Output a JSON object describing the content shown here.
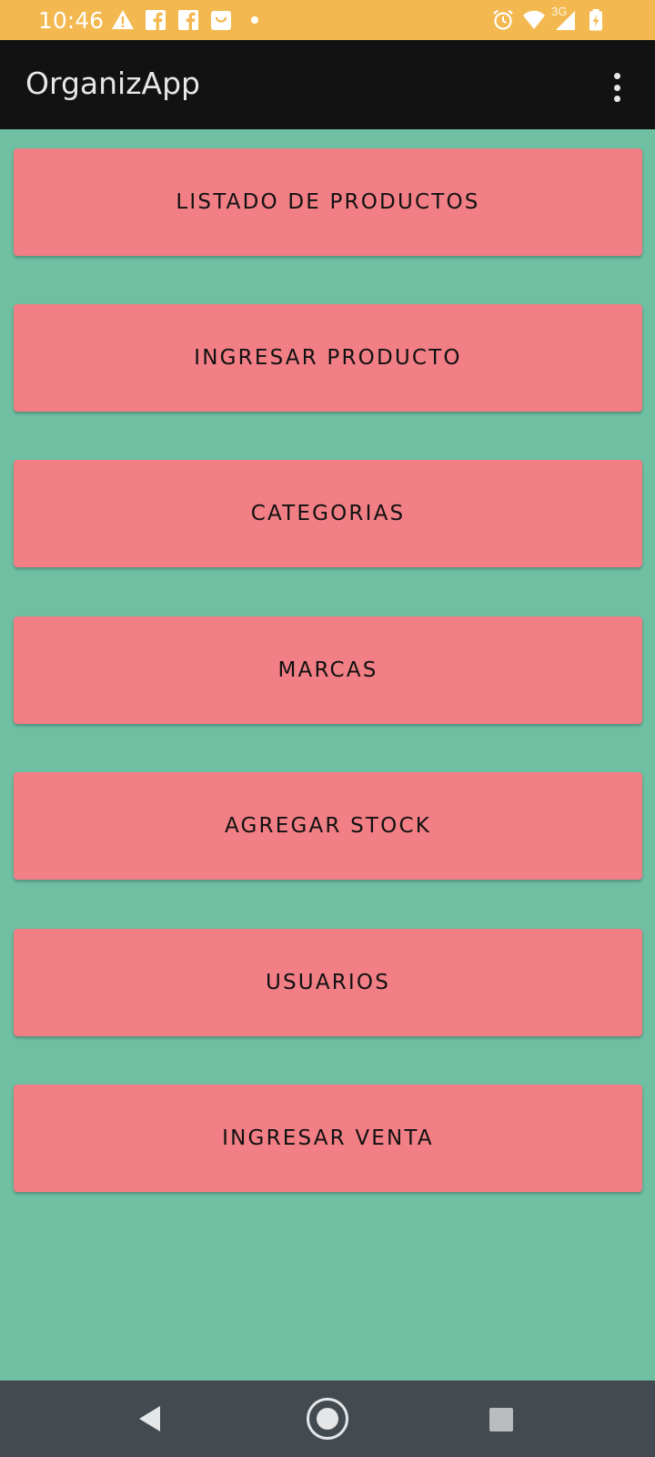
{
  "status_bar": {
    "time": "10:46",
    "network_label": "3G",
    "icons_left": [
      "warning-icon",
      "facebook-icon",
      "facebook-icon",
      "shopping-bag-icon",
      "dot-icon"
    ],
    "icons_right": [
      "alarm-icon",
      "wifi-icon",
      "signal-icon",
      "battery-charging-icon"
    ],
    "background_color": "#f3b84f"
  },
  "app_bar": {
    "title": "OrganizApp",
    "background_color": "#121212",
    "overflow_icon": "more-vert-icon"
  },
  "menu": {
    "background_color": "#6fc0a3",
    "button_color": "#f17f85",
    "items": [
      {
        "label": "LISTADO DE PRODUCTOS"
      },
      {
        "label": "INGRESAR PRODUCTO"
      },
      {
        "label": "CATEGORIAS"
      },
      {
        "label": "MARCAS"
      },
      {
        "label": "AGREGAR STOCK"
      },
      {
        "label": "USUARIOS"
      },
      {
        "label": "INGRESAR VENTA"
      }
    ]
  },
  "nav_bar": {
    "background_color": "#434a50",
    "buttons": [
      "back-icon",
      "home-icon",
      "recents-icon"
    ]
  }
}
